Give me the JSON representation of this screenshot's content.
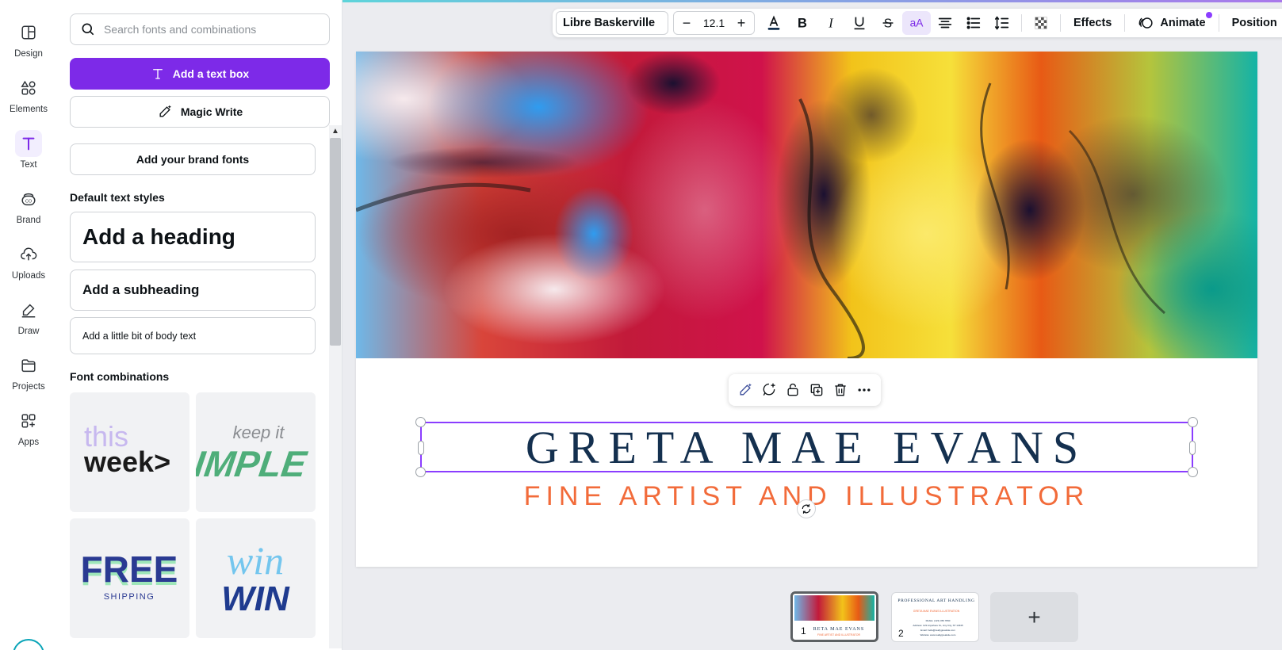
{
  "rail": {
    "items": [
      {
        "label": "Design",
        "icon": "design-icon"
      },
      {
        "label": "Elements",
        "icon": "elements-icon"
      },
      {
        "label": "Text",
        "icon": "text-icon",
        "active": true
      },
      {
        "label": "Brand",
        "icon": "brand-icon"
      },
      {
        "label": "Uploads",
        "icon": "uploads-icon"
      },
      {
        "label": "Draw",
        "icon": "draw-icon"
      },
      {
        "label": "Projects",
        "icon": "projects-icon"
      },
      {
        "label": "Apps",
        "icon": "apps-icon"
      }
    ]
  },
  "panel": {
    "search_placeholder": "Search fonts and combinations",
    "add_text_box": "Add a text box",
    "magic_write": "Magic Write",
    "brand_fonts": "Add your brand fonts",
    "default_styles_title": "Default text styles",
    "heading": "Add a heading",
    "subheading": "Add a subheading",
    "body": "Add a little bit of body text",
    "combinations_title": "Font combinations",
    "combos": [
      {
        "line1": "this",
        "line2": "week>"
      },
      {
        "line1": "keep it",
        "line2": "SIMPLE"
      },
      {
        "line1": "FREE",
        "line2": "SHIPPING"
      },
      {
        "line1": "win",
        "line2": "WIN"
      }
    ]
  },
  "toolbar": {
    "font": "Libre Baskerville",
    "size": "12.1",
    "minus": "−",
    "plus": "+",
    "effects": "Effects",
    "animate": "Animate",
    "position": "Position",
    "case_glyph": "aA",
    "text_color": "#14304f"
  },
  "canvas": {
    "title": "GRETA MAE EVANS",
    "subtitle": "FINE ARTIST AND ILLUSTRATOR",
    "title_color": "#14304f",
    "subtitle_color": "#f26b3a",
    "selection_color": "#8b3dff"
  },
  "pages": {
    "thumbs": [
      {
        "num": "1",
        "title": "RETA MAE EVANS",
        "sub": "FINE ARTIST AND ILLUSTRATOR"
      },
      {
        "num": "2",
        "title": "PROFESSIONAL ART HANDLING",
        "sub": "GRETA MAE EVANS ILLUSTRATION",
        "lines": [
          "Mobile: (123) 456 7890",
          "Address: 123 Anywhere St., Any City, ST 12345",
          "Email: hello@reallygreatsite.com",
          "Website: www.reallygreatsite.com"
        ]
      }
    ],
    "add_label": "+"
  },
  "colors": {
    "accent": "#7d2ae8",
    "primary_button": "#7d2ae8"
  }
}
